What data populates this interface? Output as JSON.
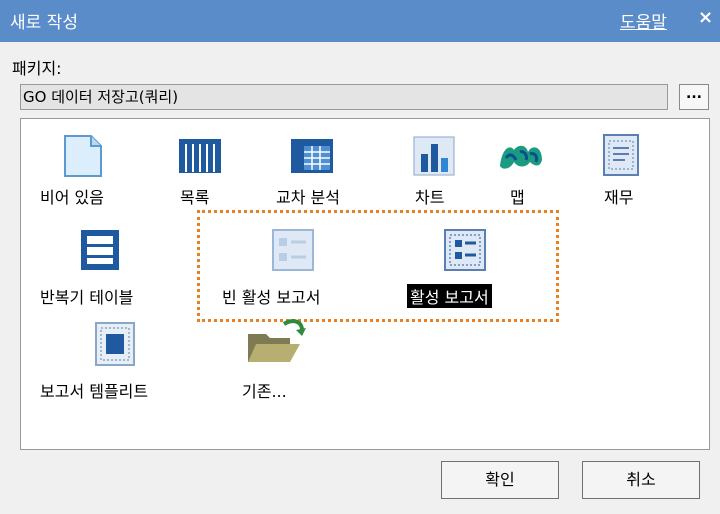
{
  "window": {
    "title": "새로 작성",
    "help": "도움말",
    "close": "×"
  },
  "package": {
    "label": "패키지:",
    "value": "GO 데이터 저장고(쿼리)",
    "browse": "..."
  },
  "items": [
    {
      "label": "비어 있음"
    },
    {
      "label": "목록"
    },
    {
      "label": "교차 분석"
    },
    {
      "label": "차트"
    },
    {
      "label": "맵"
    },
    {
      "label": "재무"
    },
    {
      "label": "반복기 테이블"
    },
    {
      "label": "빈 활성 보고서"
    },
    {
      "label": "활성 보고서"
    },
    {
      "label": "보고서 템플리트"
    },
    {
      "label": "기존..."
    }
  ],
  "buttons": {
    "ok": "확인",
    "cancel": "취소"
  },
  "colors": {
    "titlebar": "#5a8cc9",
    "selection_outline": "#e8801f"
  }
}
